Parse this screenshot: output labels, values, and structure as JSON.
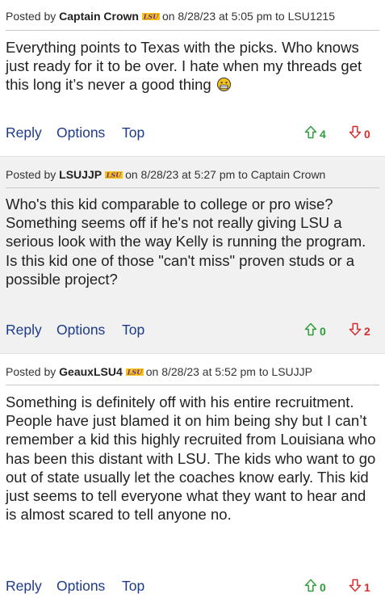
{
  "colors": {
    "link": "#1e3a8a",
    "upvote": "#2e9e3a",
    "downvote": "#d32f2f",
    "alt_background": "#f1f1f1",
    "badge": "#6a2b8a"
  },
  "posts": [
    {
      "posted_by_label": "Posted by",
      "username": "Captain Crown",
      "badge": "LSU",
      "meta": "on 8/28/23 at 5:05 pm to LSU1215",
      "body": "Everything points to Texas with the picks. Who knows just ready for it to be over. I hate when my threads get this long it’s never a good thing",
      "emoji": "😩",
      "actions": {
        "reply": "Reply",
        "options": "Options",
        "top": "Top"
      },
      "upvotes": "4",
      "downvotes": "0"
    },
    {
      "posted_by_label": "Posted by",
      "username": "LSUJJP",
      "badge": "LSU",
      "meta": "on 8/28/23 at 5:27 pm to Captain Crown",
      "body": "Who's this kid comparable to college or pro wise? Something seems off if he's not really giving LSU a serious look with the way Kelly is running the program. Is this kid one of those \"can't miss\" proven studs or a possible project?",
      "actions": {
        "reply": "Reply",
        "options": "Options",
        "top": "Top"
      },
      "upvotes": "0",
      "downvotes": "2"
    },
    {
      "posted_by_label": "Posted by",
      "username": "GeauxLSU4",
      "badge": "LSU",
      "meta": "on 8/28/23 at 5:52 pm to LSUJJP",
      "body": "Something is definitely off with his entire recruitment. People have just blamed it on him being shy but I can’t remember a kid this highly recruited from Louisiana who has been this distant with LSU. The kids who want to go out of state usually let the coaches know early. This kid just seems to tell everyone what they want to hear and is almost scared to tell anyone no.",
      "actions": {
        "reply": "Reply",
        "options": "Options",
        "top": "Top"
      },
      "upvotes": "0",
      "downvotes": "1"
    }
  ]
}
